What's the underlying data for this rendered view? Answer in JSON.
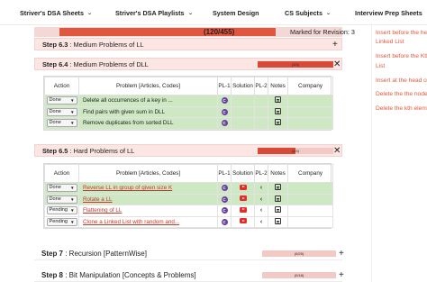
{
  "nav": {
    "items": [
      {
        "label": "Striver's DSA Sheets",
        "chevron": true
      },
      {
        "label": "Striver's DSA Playlists",
        "chevron": true
      },
      {
        "label": "System Design",
        "chevron": false
      },
      {
        "label": "CS Subjects",
        "chevron": true
      },
      {
        "label": "Interview Prep Sheets",
        "chevron": true
      }
    ]
  },
  "overall": {
    "count": "(120/455)",
    "marked_label": "Marked for Revision: 3",
    "progress": 0.264
  },
  "steps": {
    "s63": {
      "num": "Step 6.3",
      "title": " : Medium Problems of LL",
      "toggle": "+"
    },
    "s64": {
      "num": "Step 6.4",
      "title": " : Medium Problems of DLL",
      "progress_text": "(3/3)",
      "progress": 1.0,
      "toggle": "✕"
    },
    "s65": {
      "num": "Step 6.5",
      "title": " : Hard Problems of LL",
      "progress_text": "(2/4)",
      "progress": 0.5,
      "toggle": "✕"
    },
    "s7": {
      "num": "Step 7",
      "title": " : Recursion [PatternWise]",
      "progress_text": "(0/25)",
      "progress": 0,
      "toggle": "+"
    },
    "s8": {
      "num": "Step 8",
      "title": " : Bit Manipulation [Concepts & Problems]",
      "progress_text": "(0/18)",
      "progress": 0,
      "toggle": "+"
    }
  },
  "table_headers": {
    "action": "Action",
    "problem": "Problem [Articles, Codes]",
    "pl1": "PL-1",
    "solution": "Solution",
    "pl2": "PL-2",
    "notes": "Notes",
    "company": "Company"
  },
  "dll_rows": [
    {
      "status": "Done",
      "problem": "Delete all occurrences of a key in ..."
    },
    {
      "status": "Done",
      "problem": "Find pairs with given sum in DLL"
    },
    {
      "status": "Done",
      "problem": "Remove duplicates from sorted DLL"
    }
  ],
  "hard_rows": [
    {
      "status": "Done",
      "problem": "Reverse LL in group of given size K"
    },
    {
      "status": "Done",
      "problem": "Rotate a LL"
    },
    {
      "status": "Pending",
      "problem": "Flattening of LL"
    },
    {
      "status": "Pending",
      "problem": "Clone a Linked List with random and..."
    }
  ],
  "sidebar": {
    "items": [
      "Insert before the he",
      "Linked List",
      "Insert before the Kth",
      "List",
      "Insert at the head of",
      "Delete the the node with",
      "Delete the kth elem"
    ]
  },
  "colors": {
    "accent": "#e0563f",
    "done_row": "#cfe8c4",
    "step_bg": "#fbe6e4",
    "link": "#c0392b"
  },
  "icons": {
    "pl1": "c-plus-plus-icon",
    "solution": "youtube-icon",
    "pl2": "leetcode-icon",
    "notes": "note-icon"
  }
}
